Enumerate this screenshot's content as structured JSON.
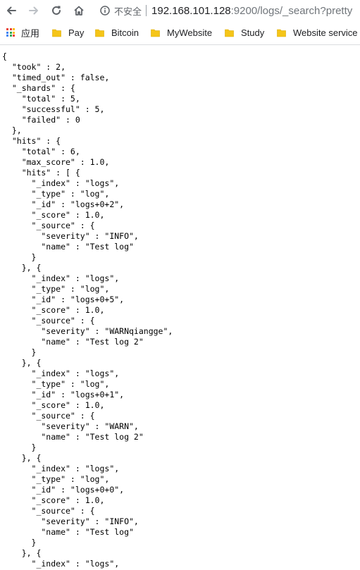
{
  "toolbar": {
    "back_icon": "back-arrow-icon",
    "forward_icon": "forward-arrow-icon",
    "reload_icon": "reload-icon",
    "home_icon": "home-icon",
    "security_icon": "info-circle-icon",
    "security_label": "不安全",
    "url_host": "192.168.101.128",
    "url_path": ":9200/logs/_search?pretty"
  },
  "bookmarks": {
    "apps_label": "应用",
    "items": [
      {
        "label": "Pay",
        "icon": "folder-icon"
      },
      {
        "label": "Bitcoin",
        "icon": "folder-icon"
      },
      {
        "label": "MyWebsite",
        "icon": "folder-icon"
      },
      {
        "label": "Study",
        "icon": "folder-icon"
      },
      {
        "label": "Website service p",
        "icon": "folder-icon"
      }
    ],
    "folder_color": "#f5c518"
  },
  "response": {
    "took": 2,
    "timed_out": false,
    "shards": {
      "total": 5,
      "successful": 5,
      "failed": 0
    },
    "hits_total": 6,
    "max_score": "1.0",
    "hits": [
      {
        "index": "logs",
        "type": "log",
        "id": "logs+0+2",
        "score": "1.0",
        "severity": "INFO",
        "name": "Test log"
      },
      {
        "index": "logs",
        "type": "log",
        "id": "logs+0+5",
        "score": "1.0",
        "severity": "WARNqiangge",
        "name": "Test log 2"
      },
      {
        "index": "logs",
        "type": "log",
        "id": "logs+0+1",
        "score": "1.0",
        "severity": "WARN",
        "name": "Test log 2"
      },
      {
        "index": "logs",
        "type": "log",
        "id": "logs+0+0",
        "score": "1.0",
        "severity": "INFO",
        "name": "Test log"
      },
      {
        "index": "logs"
      }
    ]
  }
}
